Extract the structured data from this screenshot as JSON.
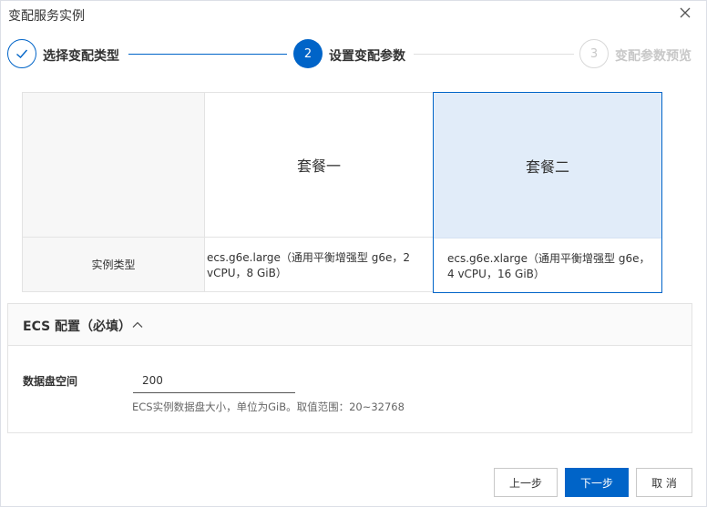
{
  "dialog": {
    "title": "变配服务实例"
  },
  "steps": [
    {
      "number": "1",
      "label": "选择变配类型",
      "status": "done",
      "icon": "check-icon"
    },
    {
      "number": "2",
      "label": "设置变配参数",
      "status": "active"
    },
    {
      "number": "3",
      "label": "变配参数预览",
      "status": "pending"
    }
  ],
  "plans": {
    "row_label": "实例类型",
    "plan1": {
      "name": "套餐一",
      "spec": "ecs.g6e.large（通用平衡增强型 g6e，2 vCPU，8 GiB）"
    },
    "plan2": {
      "name": "套餐二",
      "spec": "ecs.g6e.xlarge（通用平衡增强型 g6e，4 vCPU，16 GiB）",
      "selected": true
    }
  },
  "ecs": {
    "title": "ECS 配置（必填）",
    "disk_label": "数据盘空间",
    "disk_value": "200",
    "disk_help": "ECS实例数据盘大小，单位为GiB。取值范围：20~32768"
  },
  "footer": {
    "prev_label": "上一步",
    "next_label": "下一步",
    "cancel_label": "取 消"
  },
  "colors": {
    "primary": "#0064c8",
    "selected_bg": "#e1ecf9",
    "muted": "#c8c8c8"
  }
}
